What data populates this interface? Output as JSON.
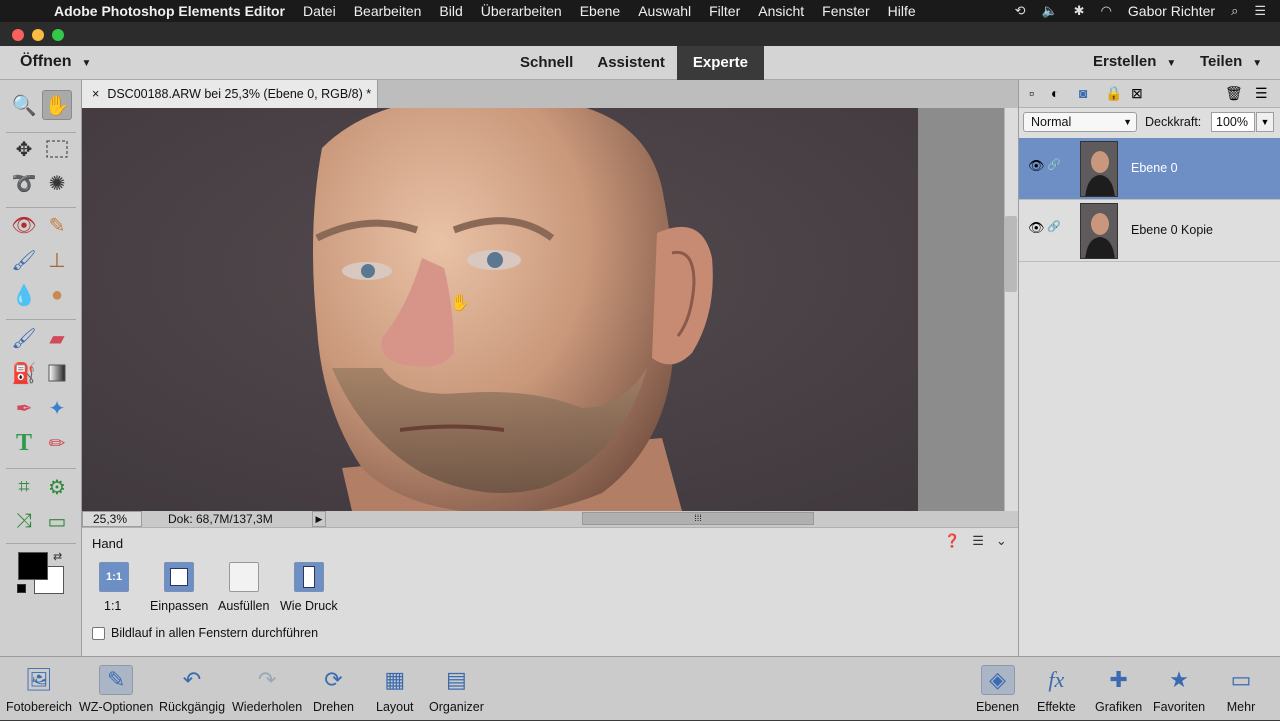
{
  "menubar": {
    "app_name": "Adobe Photoshop Elements Editor",
    "menus": [
      "Datei",
      "Bearbeiten",
      "Bild",
      "Überarbeiten",
      "Ebene",
      "Auswahl",
      "Filter",
      "Ansicht",
      "Fenster",
      "Hilfe"
    ],
    "user": "Gabor Richter"
  },
  "modebar": {
    "open_label": "Öffnen",
    "modes": [
      "Schnell",
      "Assistent",
      "Experte"
    ],
    "active_mode": "Experte",
    "create_label": "Erstellen",
    "share_label": "Teilen"
  },
  "document": {
    "tab_title": "DSC00188.ARW bei 25,3% (Ebene 0, RGB/8) *",
    "zoom": "25,3%",
    "doc_size": "Dok: 68,7M/137,3M"
  },
  "tool_options": {
    "tool_name": "Hand",
    "buttons": [
      {
        "label": "1:1",
        "icon_text": "1:1"
      },
      {
        "label": "Einpassen"
      },
      {
        "label": "Ausfüllen"
      },
      {
        "label": "Wie Druck"
      }
    ],
    "checkbox_label": "Bildlauf in allen Fenstern durchführen",
    "checkbox_checked": false
  },
  "layers_panel": {
    "blend_mode": "Normal",
    "opacity_label": "Deckkraft:",
    "opacity_value": "100%",
    "layers": [
      {
        "name": "Ebene 0",
        "active": true
      },
      {
        "name": "Ebene 0 Kopie",
        "active": false
      }
    ]
  },
  "bottombar": {
    "left_items": [
      "Fotobereich",
      "WZ-Optionen",
      "Rückgängig",
      "Wiederholen",
      "Drehen",
      "Layout",
      "Organizer"
    ],
    "right_items": [
      "Ebenen",
      "Effekte",
      "Grafiken",
      "Favoriten",
      "Mehr"
    ]
  },
  "colors": {
    "accent": "#6d8fc6",
    "canvas_bg": "#4a4246",
    "foreground_swatch": "#000000",
    "background_swatch": "#ffffff"
  }
}
